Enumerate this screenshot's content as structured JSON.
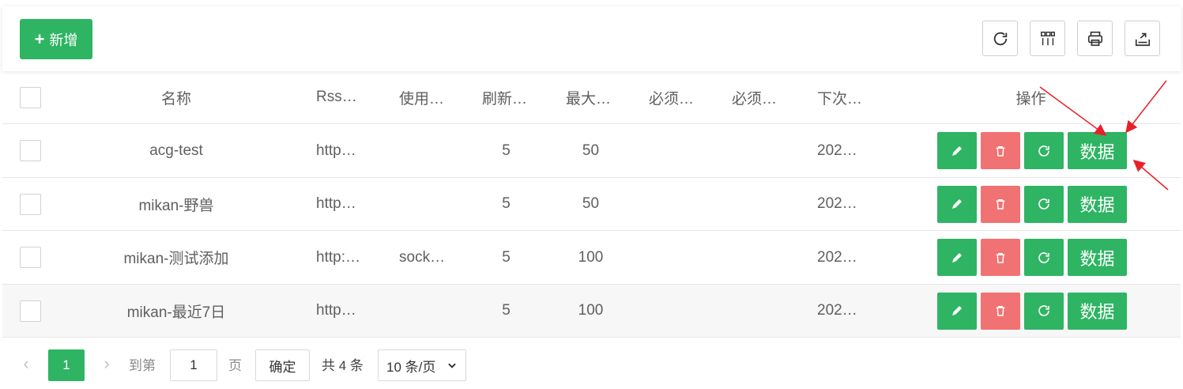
{
  "toolbar": {
    "add_label": "新增",
    "tools": [
      "refresh-icon",
      "columns-icon",
      "print-icon",
      "export-icon"
    ]
  },
  "table": {
    "headers": {
      "name": "名称",
      "rss": "Rss…",
      "use": "使用…",
      "refresh": "刷新…",
      "max": "最大…",
      "must1": "必须…",
      "must2": "必须…",
      "next": "下次…",
      "op": "操作"
    },
    "rows": [
      {
        "name": "acg-test",
        "rss": "http…",
        "use": "",
        "refresh": "5",
        "max": "50",
        "must1": "",
        "must2": "",
        "next": "202…"
      },
      {
        "name": "mikan-野兽",
        "rss": "http…",
        "use": "",
        "refresh": "5",
        "max": "50",
        "must1": "",
        "must2": "",
        "next": "202…"
      },
      {
        "name": "mikan-测试添加",
        "rss": "http:…",
        "use": "sock…",
        "refresh": "5",
        "max": "100",
        "must1": "",
        "must2": "",
        "next": "202…"
      },
      {
        "name": "mikan-最近7日",
        "rss": "http…",
        "use": "",
        "refresh": "5",
        "max": "100",
        "must1": "",
        "must2": "",
        "next": "202…"
      }
    ],
    "data_button_label": "数据"
  },
  "pager": {
    "current_page": "1",
    "goto_label": "到第",
    "goto_value": "1",
    "page_label": "页",
    "confirm_label": "确定",
    "total_label": "共 4 条",
    "page_size": "10 条/页"
  },
  "colors": {
    "primary": "#2fb463",
    "danger": "#f17272",
    "annotation": "#e8202a"
  }
}
